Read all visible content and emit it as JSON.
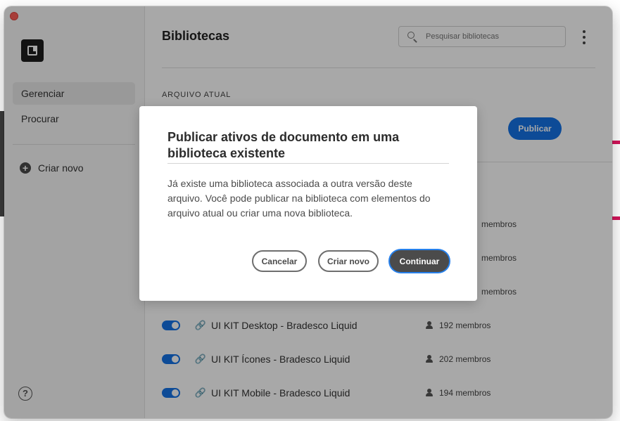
{
  "sidebar": {
    "nav": [
      {
        "label": "Gerenciar",
        "active": true
      },
      {
        "label": "Procurar",
        "active": false
      }
    ],
    "create_new": "Criar novo",
    "help": "?"
  },
  "header": {
    "title": "Bibliotecas",
    "search_placeholder": "Pesquisar bibliotecas"
  },
  "current_file": {
    "section_label": "ARQUIVO ATUAL",
    "publish_label": "Publicar"
  },
  "libraries": [
    {
      "name": "",
      "members": "membros",
      "enabled": true
    },
    {
      "name": "",
      "members": "membros",
      "enabled": true
    },
    {
      "name": "",
      "members": "membros",
      "enabled": true
    },
    {
      "name": "UI KIT Desktop - Bradesco Liquid",
      "members": "192 membros",
      "enabled": true
    },
    {
      "name": "UI KIT Ícones - Bradesco Liquid",
      "members": "202 membros",
      "enabled": true
    },
    {
      "name": "UI KIT Mobile - Bradesco Liquid",
      "members": "194 membros",
      "enabled": true
    }
  ],
  "dialog": {
    "title": "Publicar ativos de documento em uma biblioteca existente",
    "body": "Já existe uma biblioteca associada a outra versão deste arquivo. Você pode publicar na biblioteca com elementos do arquivo atual ou criar uma nova biblioteca.",
    "cancel_label": "Cancelar",
    "create_label": "Criar novo",
    "continue_label": "Continuar"
  },
  "colors": {
    "accent": "#1473e6",
    "focus_ring": "#2680eb",
    "close_button": "#fe5f57",
    "background_accent": "#d4145a"
  }
}
